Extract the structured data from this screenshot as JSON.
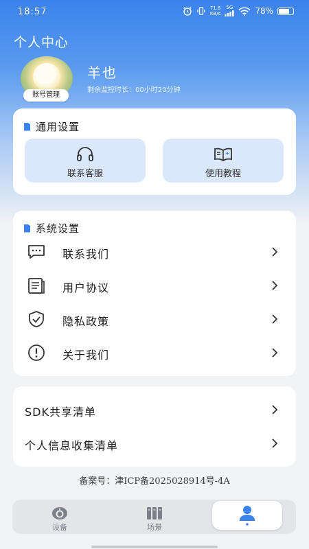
{
  "status_bar": {
    "time": "18:57",
    "net_speed_value": "71.6",
    "net_speed_unit": "KB/s",
    "network": "5G",
    "battery": "78%",
    "battery_level": 0.78
  },
  "header": {
    "title": "个人中心",
    "username": "羊也",
    "remaining_time": "剩余监控时长：00小时20分钟",
    "avatar_badge": "账号管理"
  },
  "general_settings": {
    "title": "通用设置",
    "tiles": [
      {
        "label": "联系客服",
        "icon": "headset-icon"
      },
      {
        "label": "使用教程",
        "icon": "book-icon"
      }
    ]
  },
  "system_settings": {
    "title": "系统设置",
    "items": [
      {
        "label": "联系我们",
        "icon": "message-icon"
      },
      {
        "label": "用户协议",
        "icon": "document-icon"
      },
      {
        "label": "隐私政策",
        "icon": "shield-check-icon"
      },
      {
        "label": "关于我们",
        "icon": "info-alert-icon"
      }
    ]
  },
  "lists": {
    "items": [
      {
        "label": "SDK共享清单"
      },
      {
        "label": "个人信息收集清单"
      }
    ]
  },
  "footer": {
    "icp": "备案号：津ICP备2025028914号-4A"
  },
  "tabbar": {
    "tabs": [
      {
        "label": "设备",
        "icon": "device-icon"
      },
      {
        "label": "场景",
        "icon": "scene-icon"
      },
      {
        "label": "",
        "icon": "user-icon",
        "active": true
      }
    ]
  },
  "colors": {
    "accent": "#3b82ec",
    "tile_bg": "#dbe8fb",
    "page_bg": "#f2f3f5"
  }
}
